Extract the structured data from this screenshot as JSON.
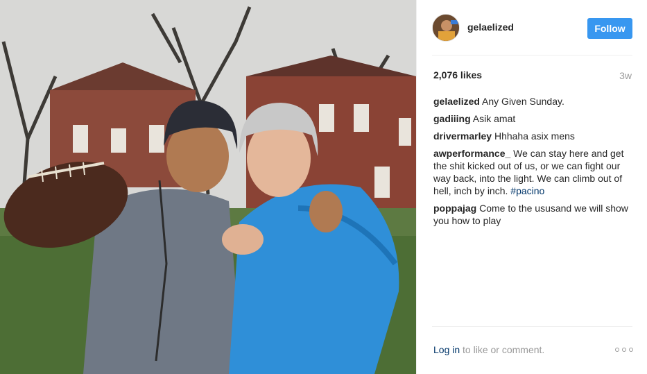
{
  "post": {
    "username": "gelaelized",
    "follow_label": "Follow",
    "likes": "2,076 likes",
    "time": "3w"
  },
  "comments": [
    {
      "author": "gelaelized",
      "text": "Any Given Sunday.",
      "hashtag": ""
    },
    {
      "author": "gadiiing",
      "text": "Asik amat",
      "hashtag": ""
    },
    {
      "author": "drivermarley",
      "text": "Hhhaha asix mens",
      "hashtag": ""
    },
    {
      "author": "awperformance_",
      "text": "We can stay here and get the shit kicked out of us, or we can fight our way back, into the light. We can climb out of hell, inch by inch.",
      "hashtag": "#pacino"
    },
    {
      "author": "poppajag",
      "text": "Come to the ususand we will show you how to play",
      "hashtag": ""
    }
  ],
  "footer": {
    "login_label": "Log in",
    "rest_label": "to like or comment."
  },
  "icons": {
    "more": "more-options-icon",
    "avatar": "avatar"
  },
  "colors": {
    "follow_button": "#3897f0",
    "link": "#003569",
    "muted": "#999999"
  }
}
